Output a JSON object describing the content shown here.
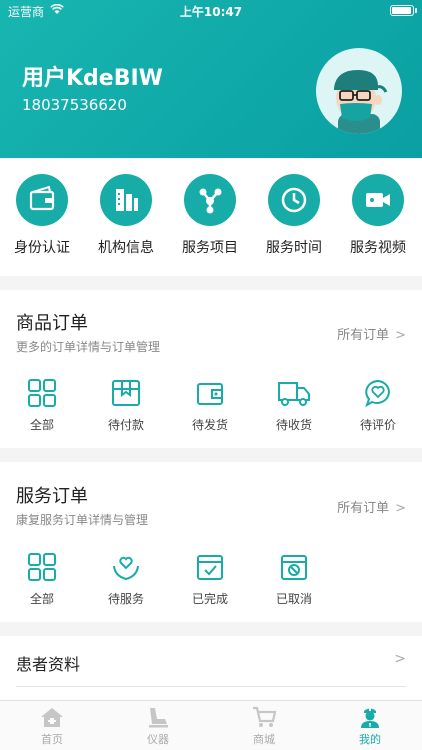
{
  "status_bar": {
    "carrier": "运营商",
    "time": "上午10:47",
    "battery_level": 1.0
  },
  "user": {
    "name": "用户KdeBIW",
    "phone": "18037536620"
  },
  "quick_actions": [
    {
      "label": "身份认证",
      "icon": "wallet-icon"
    },
    {
      "label": "机构信息",
      "icon": "building-icon"
    },
    {
      "label": "服务项目",
      "icon": "nodes-icon"
    },
    {
      "label": "服务时间",
      "icon": "clock-icon"
    },
    {
      "label": "服务视频",
      "icon": "video-icon"
    }
  ],
  "goods_orders": {
    "title": "商品订单",
    "subtitle": "更多的订单详情与订单管理",
    "link": "所有订单",
    "items": [
      {
        "label": "全部",
        "icon": "grid-icon"
      },
      {
        "label": "待付款",
        "icon": "package-icon"
      },
      {
        "label": "待发货",
        "icon": "wallet-outline-icon"
      },
      {
        "label": "待收货",
        "icon": "truck-icon"
      },
      {
        "label": "待评价",
        "icon": "heart-bubble-icon"
      }
    ]
  },
  "service_orders": {
    "title": "服务订单",
    "subtitle": "康复服务订单详情与管理",
    "link": "所有订单",
    "items": [
      {
        "label": "全部",
        "icon": "grid-icon"
      },
      {
        "label": "待服务",
        "icon": "heart-hands-icon"
      },
      {
        "label": "已完成",
        "icon": "calendar-check-icon"
      },
      {
        "label": "已取消",
        "icon": "calendar-cancel-icon"
      }
    ]
  },
  "patient": {
    "label": "患者资料"
  },
  "tabbar": [
    {
      "label": "首页",
      "icon": "home-icon",
      "active": false
    },
    {
      "label": "仪器",
      "icon": "chair-icon",
      "active": false
    },
    {
      "label": "商城",
      "icon": "cart-icon",
      "active": false
    },
    {
      "label": "我的",
      "icon": "doctor-icon",
      "active": true
    }
  ],
  "colors": {
    "primary": "#17aca8",
    "header_start": "#19b6b0",
    "header_end": "#0b9fa3",
    "background": "#f4f4f4"
  }
}
